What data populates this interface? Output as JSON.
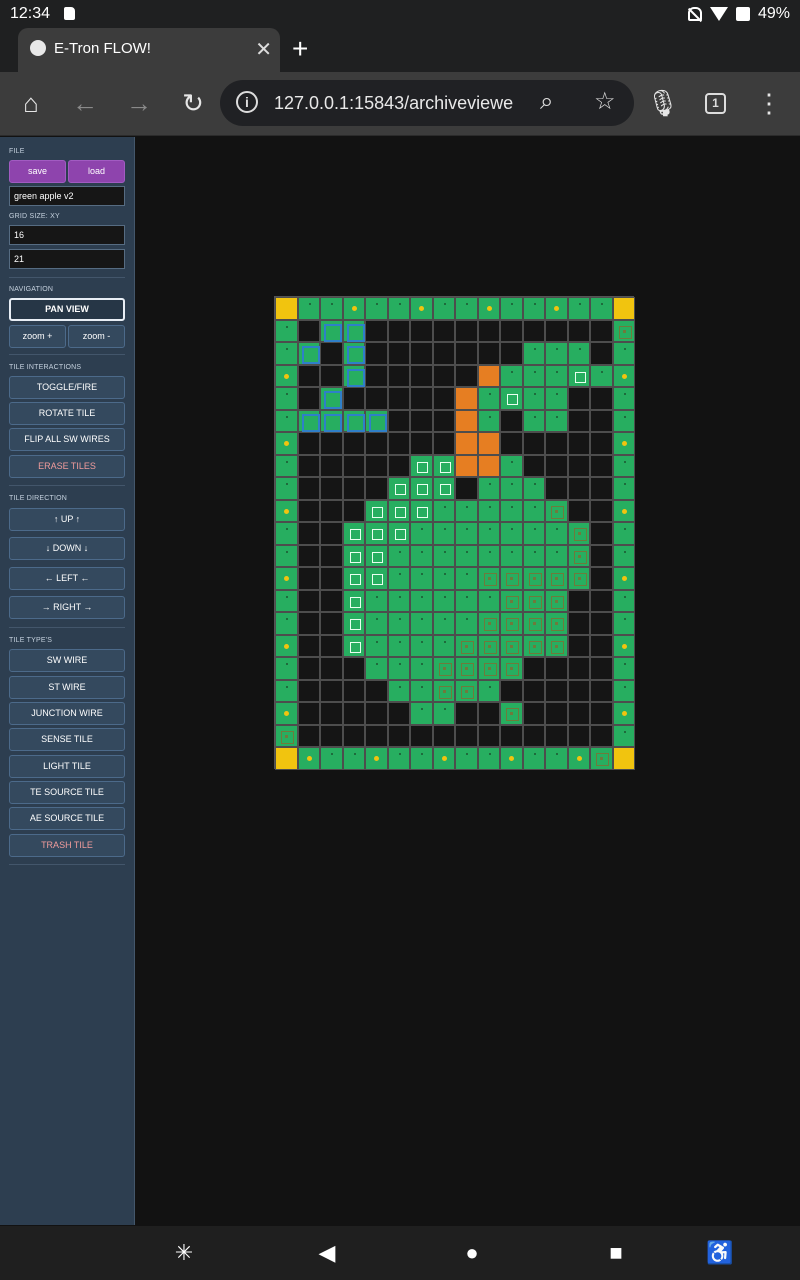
{
  "status_bar": {
    "time": "12:34",
    "battery": "49%"
  },
  "browser": {
    "tab_title": "E-Tron FLOW!",
    "url": "127.0.0.1:15843/archiveviewe",
    "tab_count": "1",
    "colors": {
      "chrome": "#3c3c3c",
      "omnibox": "#202124"
    }
  },
  "sidebar": {
    "file": {
      "heading": "FILE",
      "save": "save",
      "load": "load",
      "name_value": "green apple v2"
    },
    "grid_size": {
      "heading": "GRID SIZE: XY",
      "x_value": "16",
      "y_value": "21"
    },
    "navigation": {
      "heading": "NAVIGATION",
      "pan_view": "PAN VIEW",
      "zoom_in": "zoom +",
      "zoom_out": "zoom -"
    },
    "interactions": {
      "heading": "TILE INTERACTIONS",
      "toggle_fire": "TOGGLE/FIRE",
      "rotate_tile": "ROTATE TILE",
      "flip_sw": "FLIP ALL SW WIRES",
      "erase_tiles": "ERASE TILES"
    },
    "direction": {
      "heading": "TILE DIRECTION",
      "up": "↑ UP ↑",
      "down": "↓ DOWN ↓",
      "left": "← LEFT ←",
      "right": "→ RIGHT →"
    },
    "types": {
      "heading": "TILE TYPE'S",
      "sw_wire": "SW WIRE",
      "st_wire": "ST WIRE",
      "junction_wire": "JUNCTION WIRE",
      "sense_tile": "SENSE TILE",
      "light_tile": "LIGHT TILE",
      "te_source": "TE SOURCE TILE",
      "ae_source": "AE SOURCE TILE",
      "trash_tile": "TRASH TILE"
    }
  },
  "grid": {
    "cols": 16,
    "rows": 20,
    "legend": {
      "g": "wire",
      "o": "orange",
      "y": "corner",
      "b": "blue",
      "w": "white-square",
      "j": "junction",
      "d": "dot",
      ".": "empty"
    },
    "colors": {
      "wire": "#27ae60",
      "orange": "#e67e22",
      "corner": "#f1c40f",
      "blue": "#2f7fc8",
      "empty": "#151515"
    },
    "rows_data": [
      "yggdggdggdggdggy",
      "g.bb...........j",
      "gb.b.......ggg.g",
      "d..b.....ogggwgd",
      "g.b.....ogwgg..g",
      "gbbbb...og.gg..g",
      "d.......oo.....d",
      "g.....wwoog....g",
      "g....www.ggg...g",
      "d...wwwgggggj..d",
      "g..wwwgggggggj.g",
      "g..wwggggggggj.g",
      "d..wwggggjjjjj.d",
      "g..wggggggjjj..g",
      "g..wgggggjjjj..g",
      "d..wggggjjjjj..d",
      "g...gggjjjj....g",
      "g....ggjjg.....g",
      "d.....gg..j....d",
      "j..............g"
    ],
    "bottom_row": "ydggdggdggdggdjy"
  }
}
